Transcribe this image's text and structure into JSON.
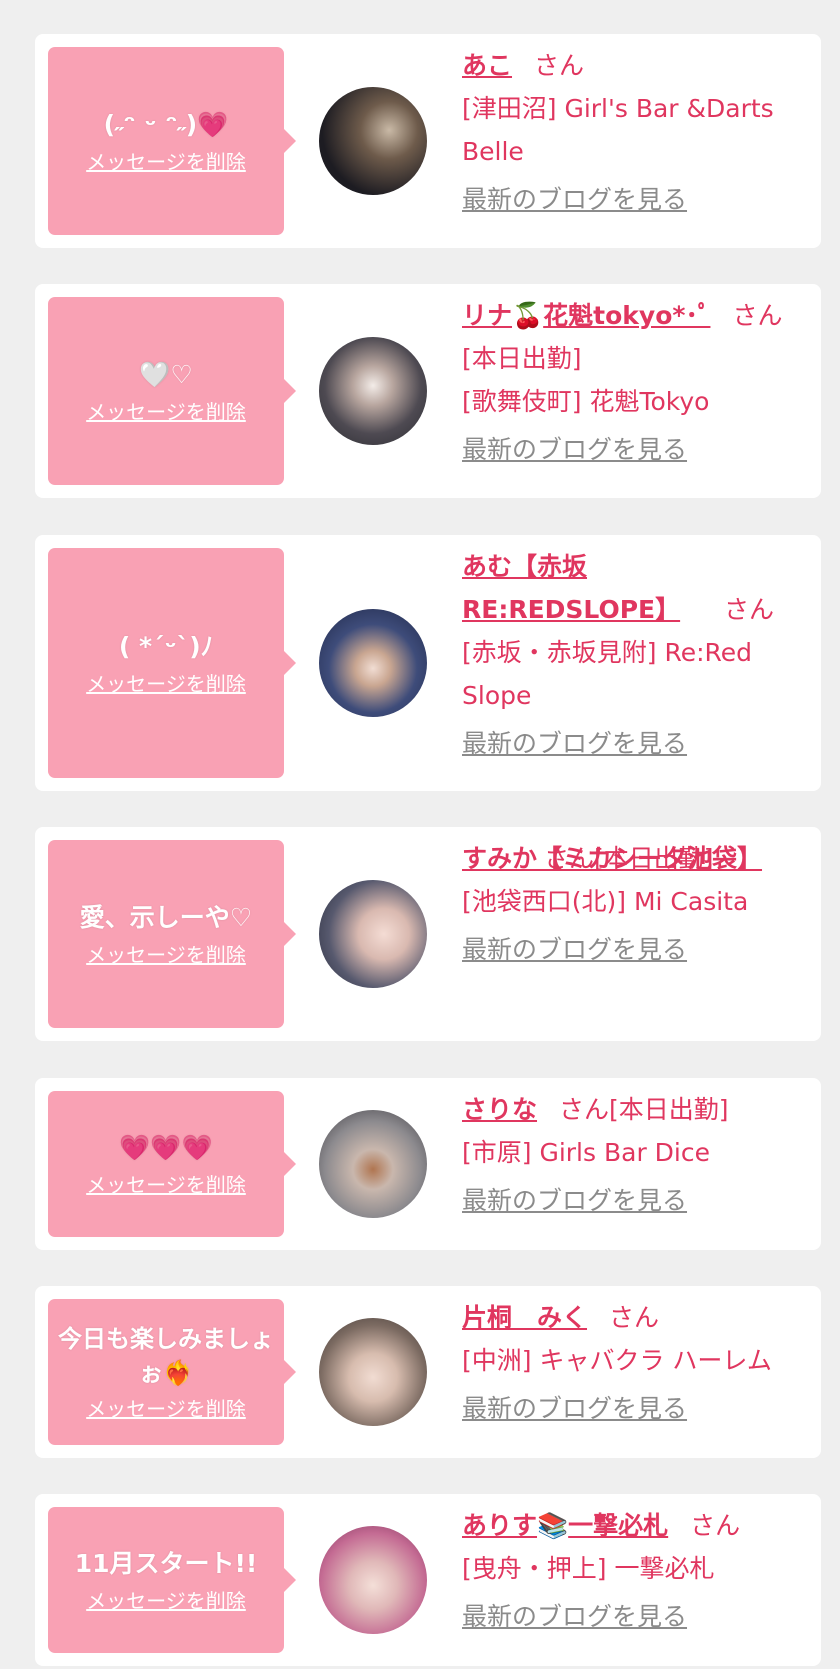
{
  "delete_label": "メッセージを削除",
  "blog_label": "最新のブログを見る",
  "honorific": "さん",
  "cards": [
    {
      "message": "(˶ᵔ ᵕ ᵔ˶)",
      "message_heart": "💗",
      "name": "あこ",
      "after_san": "",
      "lines": [
        "[津田沼] Girl's Bar &Darts Belle"
      ]
    },
    {
      "message": "🤍♡",
      "name": "リナ",
      "name_emoji": "🍒",
      "name_rest": "花魁tokyo*･ﾟ",
      "after_san": "",
      "lines": [
        "[本日出勤]",
        "[歌舞伎町] 花魁Tokyo"
      ]
    },
    {
      "message": "( *´ᵕ`)ﾉ",
      "name": "あむ【赤坂 RE:REDSLOPE】",
      "after_san": "",
      "lines": [
        "[赤坂・赤坂見附] Re:Red Slope"
      ]
    },
    {
      "message": "愛、示しーや♡",
      "name": "すみか【ミカシータ池袋】",
      "after_san": "[本日出勤]",
      "lines": [
        "[池袋西口(北)] Mi Casita"
      ]
    },
    {
      "message": "💗💗💗",
      "name": "さりな",
      "after_san": "[本日出勤]",
      "lines": [
        "[市原] Girls Bar Dice"
      ]
    },
    {
      "message": "今日も楽しみましょぉ❤️‍🔥",
      "name": "片桐　みく",
      "after_san": "",
      "lines": [
        "[中洲] キャバクラ ハーレム"
      ]
    },
    {
      "message": "11月スタート!!",
      "name": "ありす",
      "name_emoji": "📚",
      "name_rest": "一撃必札",
      "after_san": "",
      "lines": [
        "[曳舟・押上] 一撃必札"
      ]
    }
  ],
  "colors": {
    "bubble": "#f9a1b4",
    "accent": "#e0365f",
    "link_gray": "#8b8b8b",
    "background": "#efefef"
  }
}
